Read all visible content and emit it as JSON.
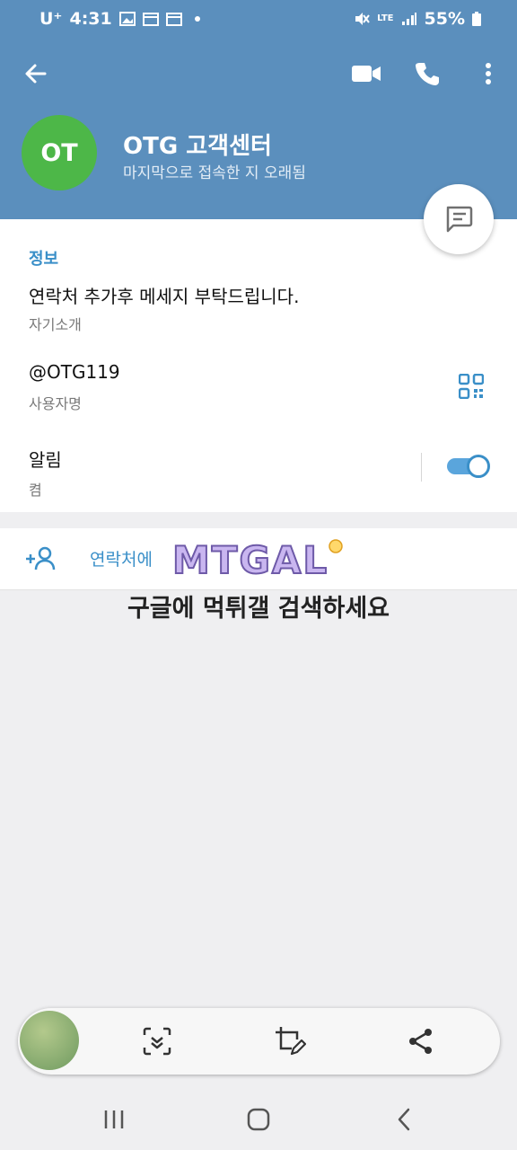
{
  "status_bar": {
    "carrier": "U⁺",
    "time": "4:31",
    "network": "LTE",
    "battery": "55%"
  },
  "header": {
    "avatar_initials": "OT",
    "name": "OTG 고객센터",
    "last_seen": "마지막으로 접속한 지 오래됨"
  },
  "info": {
    "section_title": "정보",
    "bio": "연락처 추가후 메세지 부탁드립니다.",
    "bio_label": "자기소개",
    "username": "@OTG119",
    "username_label": "사용자명",
    "notifications": "알림",
    "notifications_state": "켬",
    "notifications_on": true
  },
  "contact_row": {
    "add_label": "연락처에",
    "logo_text": "MTGAL"
  },
  "overlay_text": "구글에 먹튀갤 검색하세요",
  "colors": {
    "header_bg": "#5b8fbd",
    "accent": "#3a8fc8",
    "avatar": "#4db748"
  },
  "icons": {
    "back": "arrow-left-icon",
    "video": "video-call-icon",
    "phone": "phone-icon",
    "more": "more-vert-icon",
    "message": "message-icon",
    "qr": "qr-code-icon",
    "add_contact": "add-person-icon"
  }
}
